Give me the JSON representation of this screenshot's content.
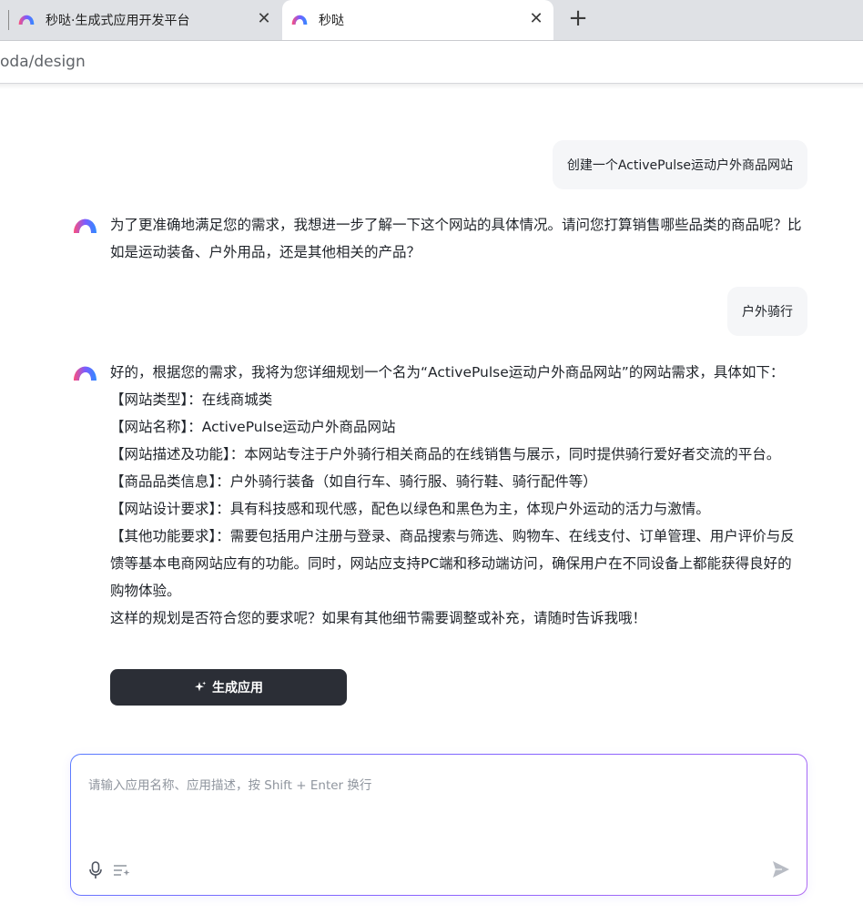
{
  "browser": {
    "tabs": [
      {
        "title": "秒哒·生成式应用开发平台",
        "close": "✕"
      },
      {
        "title": "秒哒",
        "close": "✕"
      }
    ],
    "new_tab": "+",
    "url": "oda/design"
  },
  "chat": {
    "user_message_1": "创建一个ActivePulse运动户外商品网站",
    "bot_message_1": "为了更准确地满足您的需求，我想进一步了解一下这个网站的具体情况。请问您打算销售哪些品类的商品呢？比如是运动装备、户外用品，还是其他相关的产品？",
    "user_message_2": "户外骑行",
    "bot_message_2": {
      "lines": [
        "好的，根据您的需求，我将为您详细规划一个名为“ActivePulse运动户外商品网站”的网站需求，具体如下：",
        "【网站类型】：在线商城类",
        "【网站名称】：ActivePulse运动户外商品网站",
        "【网站描述及功能】：本网站专注于户外骑行相关商品的在线销售与展示，同时提供骑行爱好者交流的平台。",
        "【商品品类信息】：户外骑行装备（如自行车、骑行服、骑行鞋、骑行配件等）",
        "【网站设计要求】：具有科技感和现代感，配色以绿色和黑色为主，体现户外运动的活力与激情。",
        "【其他功能要求】：需要包括用户注册与登录、商品搜索与筛选、购物车、在线支付、订单管理、用户评价与反馈等基本电商网站应有的功能。同时，网站应支持PC端和移动端访问，确保用户在不同设备上都能获得良好的购物体验。",
        "这样的规划是否符合您的要求呢？如果有其他细节需要调整或补充，请随时告诉我哦！"
      ]
    },
    "generate_button": "生成应用"
  },
  "composer": {
    "placeholder": "请输入应用名称、应用描述，按 Shift + Enter 换行",
    "value": ""
  },
  "colors": {
    "accent_gradient_start": "#5b7cff",
    "accent_gradient_end": "#b06cf2",
    "button_bg": "#2b2e36",
    "bubble_bg": "#f5f6f8"
  }
}
